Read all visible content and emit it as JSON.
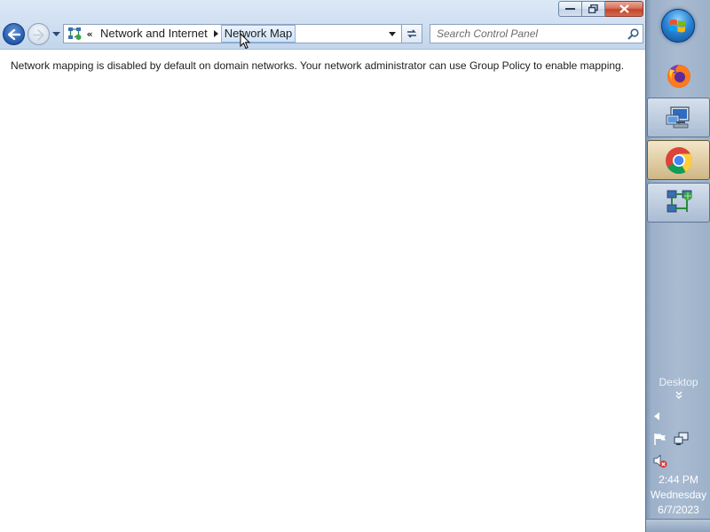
{
  "window": {
    "caption_buttons": [
      "minimize",
      "restore",
      "close"
    ]
  },
  "navigation": {
    "back_icon": "back-arrow-icon",
    "forward_icon": "forward-arrow-icon"
  },
  "address_bar": {
    "overflow_chevron": "«",
    "crumbs": [
      "Network and Internet",
      "Network Map"
    ],
    "icon": "network-map-icon"
  },
  "search": {
    "placeholder": "Search Control Panel"
  },
  "content": {
    "message": "Network mapping is disabled by default on domain networks. Your network administrator can use Group Policy to enable mapping."
  },
  "taskbar": {
    "pinned": [
      {
        "name": "firefox",
        "icon": "firefox-icon",
        "state": "pinned"
      },
      {
        "name": "remote-desktop",
        "icon": "remote-desktop-icon",
        "state": "running"
      },
      {
        "name": "chrome",
        "icon": "chrome-icon",
        "state": "active"
      },
      {
        "name": "network",
        "icon": "network-icon",
        "state": "running"
      }
    ],
    "desktop_label": "Desktop",
    "desktop_chevron": "»",
    "clock": {
      "time": "2:44 PM",
      "day": "Wednesday",
      "date": "6/7/2023"
    }
  },
  "colors": {
    "accent": "#2459ad",
    "close_button": "#c1442a",
    "taskbar": "#a9bbd1"
  }
}
